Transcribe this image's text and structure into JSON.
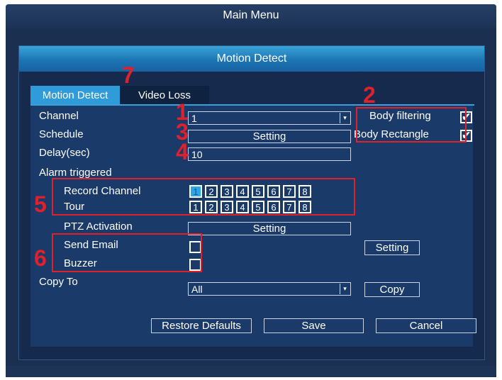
{
  "window": {
    "title": "Main Menu"
  },
  "dialog": {
    "title": "Motion Detect"
  },
  "tabs": [
    {
      "label": "Motion Detect"
    },
    {
      "label": "Video Loss"
    }
  ],
  "form": {
    "channel": {
      "label": "Channel",
      "value": "1"
    },
    "schedule": {
      "label": "Schedule",
      "button": "Setting"
    },
    "delay": {
      "label": "Delay(sec)",
      "value": "10"
    },
    "alarm_triggered": {
      "label": "Alarm triggered"
    },
    "record_channel": {
      "label": "Record Channel",
      "channels": [
        "1",
        "2",
        "3",
        "4",
        "5",
        "6",
        "7",
        "8"
      ],
      "selected": "1"
    },
    "tour": {
      "label": "Tour",
      "channels": [
        "1",
        "2",
        "3",
        "4",
        "5",
        "6",
        "7",
        "8"
      ]
    },
    "ptz": {
      "label": "PTZ Activation",
      "button": "Setting"
    },
    "send_email": {
      "label": "Send Email",
      "checked": false,
      "button": "Setting"
    },
    "buzzer": {
      "label": "Buzzer",
      "checked": false
    },
    "copy_to": {
      "label": "Copy To",
      "value": "All",
      "button": "Copy"
    },
    "body_filtering": {
      "label": "Body filtering",
      "checked": true
    },
    "body_rectangle": {
      "label": "Body Rectangle",
      "checked": true
    }
  },
  "footer": {
    "restore": "Restore Defaults",
    "save": "Save",
    "cancel": "Cancel"
  },
  "annotations": {
    "m1": "1",
    "m2": "2",
    "m3": "3",
    "m4": "4",
    "m5": "5",
    "m6": "6",
    "m7": "7"
  },
  "icons": {
    "checkmark": "✔",
    "dropdown": "▾"
  },
  "colors": {
    "accent": "#2f9bd8",
    "annotation": "#e0202a",
    "panel": "#1a3a6a"
  }
}
